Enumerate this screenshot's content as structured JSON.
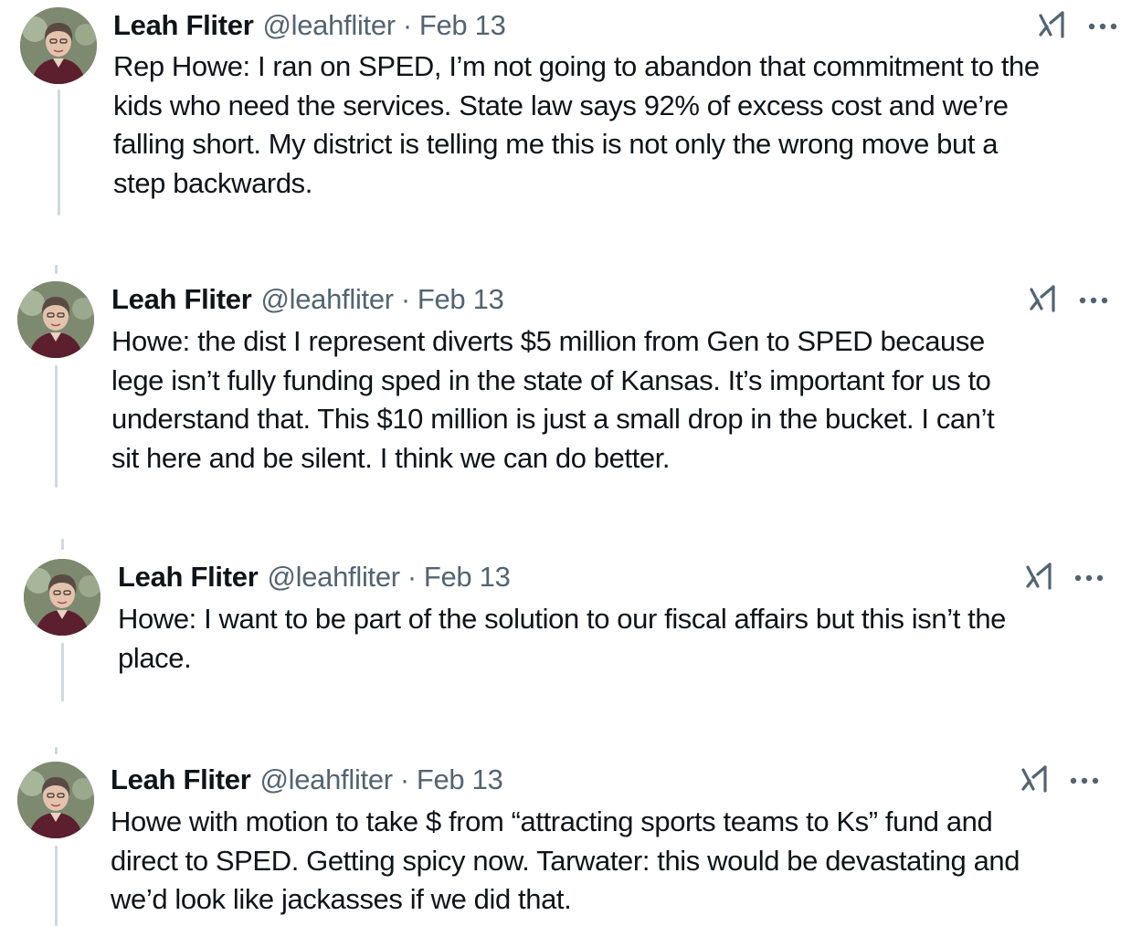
{
  "tweets": [
    {
      "author": {
        "name": "Leah Fliter",
        "handle": "@leahfliter",
        "separator": "·",
        "date": "Feb 13"
      },
      "text": "Rep Howe: I ran on SPED, I’m not going to abandon that commitment to the\nkids who need the services. State law says 92% of excess cost and we’re\nfalling short. My district is telling me this is not only the wrong move but a\nstep backwards."
    },
    {
      "author": {
        "name": "Leah Fliter",
        "handle": "@leahfliter",
        "separator": "·",
        "date": "Feb 13"
      },
      "text": "Howe: the dist I represent diverts $5 million from Gen to SPED because\nlege isn’t fully funding sped in the state of Kansas. It’s important for us to\nunderstand that. This $10 million is just a small drop in the bucket. I can’t\nsit here and be silent. I think we can do better."
    },
    {
      "author": {
        "name": "Leah Fliter",
        "handle": "@leahfliter",
        "separator": "·",
        "date": "Feb 13"
      },
      "text": "Howe: I want to be part of the solution to our fiscal affairs but this isn’t the\nplace."
    },
    {
      "author": {
        "name": "Leah Fliter",
        "handle": "@leahfliter",
        "separator": "·",
        "date": "Feb 13"
      },
      "text": "Howe with motion to take $ from “attracting sports teams to Ks” fund and\ndirect to SPED. Getting spicy now. Tarwater: this would be devastating and\nwe’d look like jackasses if we did that."
    }
  ],
  "icons": {
    "grok": "grok-icon",
    "more": "more-options-icon",
    "avatar": "profile-photo"
  },
  "colors": {
    "text_primary": "#0f1419",
    "text_secondary": "#536471",
    "thread_line": "#cfd9de"
  }
}
